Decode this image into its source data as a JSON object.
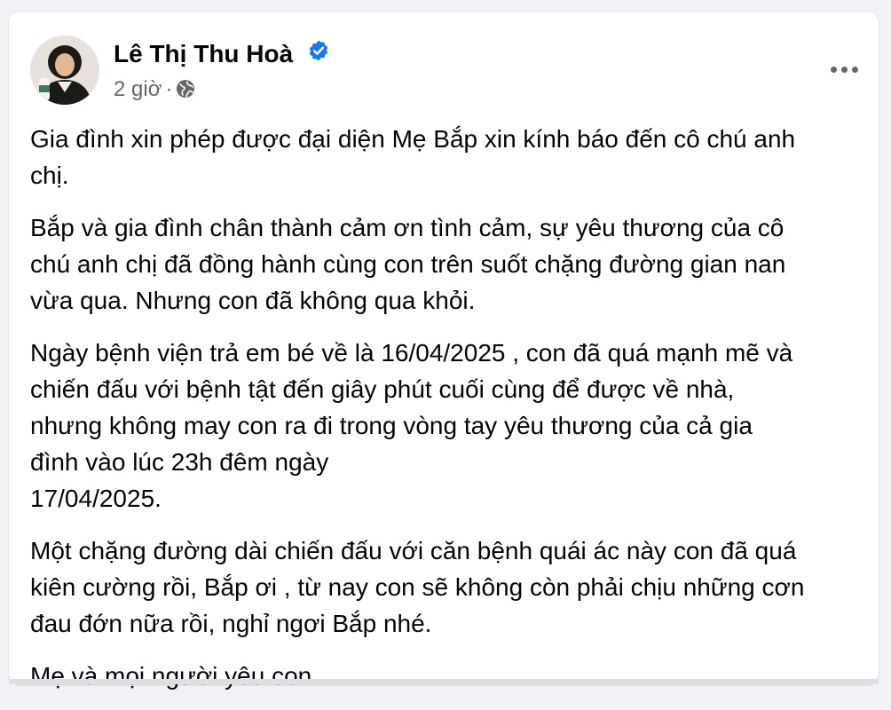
{
  "post": {
    "author": "Lê Thị Thu Hoà",
    "time": "2 giờ",
    "separator": "·",
    "privacy_icon": "globe-icon",
    "verified_icon": "verified-badge-icon",
    "more_icon": "more-options-icon",
    "paragraphs": [
      {
        "lines": [
          "Gia đình xin phép được đại diện Mẹ Bắp xin kính báo đến cô chú anh",
          "chị."
        ]
      },
      {
        "lines": [
          "Bắp và gia đình chân thành cảm ơn tình cảm, sự yêu thương của cô",
          "chú anh chị đã đồng hành cùng con trên suốt chặng đường gian nan",
          "vừa qua. Nhưng con đã không qua khỏi."
        ]
      },
      {
        "lines": [
          "Ngày bệnh viện trả em bé về là 16/04/2025 , con đã quá mạnh mẽ và",
          "chiến đấu với bệnh tật đến giây phút cuối cùng để được về nhà,",
          "nhưng không may con ra đi trong vòng tay yêu thương của cả gia",
          "đình vào lúc 23h đêm ngày",
          "17/04/2025."
        ]
      },
      {
        "lines": [
          "Một chặng đường dài chiến đấu với căn bệnh quái ác này con đã quá",
          "kiên cường rồi, Bắp ơi , từ nay con sẽ không còn phải chịu những cơn",
          "đau đớn nữa rồi, nghỉ ngơi Bắp nhé."
        ]
      },
      {
        "lines": [
          "Mẹ và mọi người yêu con."
        ]
      }
    ]
  },
  "colors": {
    "page_bg": "#f0f2f5",
    "card_bg": "#ffffff",
    "text": "#050505",
    "secondary_text": "#65676b",
    "verified_blue": "#1877f2"
  }
}
